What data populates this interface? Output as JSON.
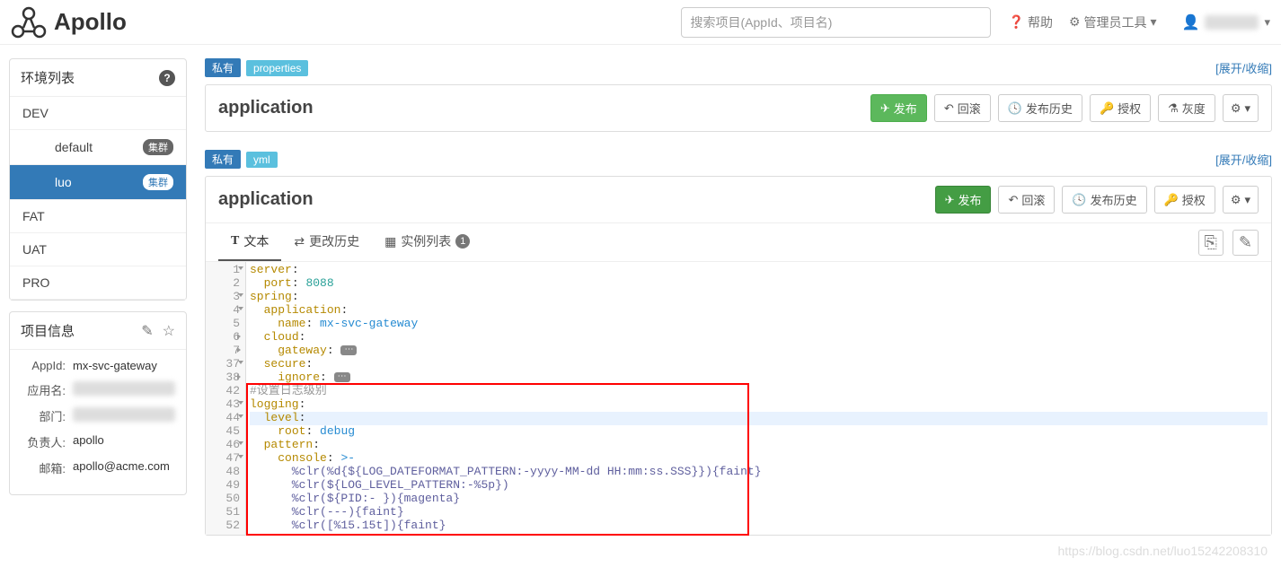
{
  "brand": "Apollo",
  "search": {
    "placeholder": "搜索项目(AppId、项目名)"
  },
  "top": {
    "help": "帮助",
    "admin": "管理员工具"
  },
  "sidebar": {
    "env_title": "环境列表",
    "items": [
      {
        "label": "DEV",
        "indent": false,
        "badge": "",
        "active": false
      },
      {
        "label": "default",
        "indent": true,
        "badge": "集群",
        "active": false
      },
      {
        "label": "luo",
        "indent": true,
        "badge": "集群",
        "active": true
      },
      {
        "label": "FAT",
        "indent": false,
        "badge": "",
        "active": false
      },
      {
        "label": "UAT",
        "indent": false,
        "badge": "",
        "active": false
      },
      {
        "label": "PRO",
        "indent": false,
        "badge": "",
        "active": false
      }
    ],
    "info_title": "项目信息",
    "info": {
      "appid_label": "AppId:",
      "appid": "mx-svc-gateway",
      "appname_label": "应用名:",
      "dept_label": "部门:",
      "owner_label": "负责人:",
      "owner": "apollo",
      "email_label": "邮箱:",
      "email": "apollo@acme.com"
    }
  },
  "ns1": {
    "private": "私有",
    "type": "properties",
    "expand": "[展开/收缩]",
    "title": "application",
    "actions": {
      "publish": "发布",
      "rollback": "回滚",
      "history": "发布历史",
      "auth": "授权",
      "gray": "灰度"
    }
  },
  "ns2": {
    "private": "私有",
    "type": "yml",
    "expand": "[展开/收缩]",
    "title": "application",
    "actions": {
      "publish": "发布",
      "rollback": "回滚",
      "history": "发布历史",
      "auth": "授权"
    },
    "tabs": {
      "text": "文本",
      "history": "更改历史",
      "instances": "实例列表",
      "count": "1"
    },
    "code": {
      "lines": [
        {
          "n": 1,
          "fold": "down",
          "raw": "server:",
          "cls": "key"
        },
        {
          "n": 2,
          "fold": "",
          "raw": "  port: 8088"
        },
        {
          "n": 3,
          "fold": "down",
          "raw": "spring:"
        },
        {
          "n": 4,
          "fold": "down",
          "raw": "  application:"
        },
        {
          "n": 5,
          "fold": "",
          "raw": "    name: mx-svc-gateway"
        },
        {
          "n": 6,
          "fold": "right",
          "raw": "  cloud:"
        },
        {
          "n": 7,
          "fold": "right",
          "raw": "    gateway:",
          "folded": true
        },
        {
          "n": 37,
          "fold": "down",
          "raw": "  secure:"
        },
        {
          "n": 38,
          "fold": "right",
          "raw": "    ignore:",
          "folded": true
        },
        {
          "n": 42,
          "fold": "",
          "raw": "#设置日志级别",
          "cls": "comment"
        },
        {
          "n": 43,
          "fold": "down",
          "raw": "logging:"
        },
        {
          "n": 44,
          "fold": "down",
          "raw": "  level:",
          "hl": true
        },
        {
          "n": 45,
          "fold": "",
          "raw": "    root: debug"
        },
        {
          "n": 46,
          "fold": "down",
          "raw": "  pattern:"
        },
        {
          "n": 47,
          "fold": "down",
          "raw": "    console: >-"
        },
        {
          "n": 48,
          "fold": "",
          "raw": "      %clr(%d{${LOG_DATEFORMAT_PATTERN:-yyyy-MM-dd HH:mm:ss.SSS}}){faint}",
          "cls": "str"
        },
        {
          "n": 49,
          "fold": "",
          "raw": "      %clr(${LOG_LEVEL_PATTERN:-%5p})",
          "cls": "str"
        },
        {
          "n": 50,
          "fold": "",
          "raw": "      %clr(${PID:- }){magenta}",
          "cls": "str"
        },
        {
          "n": 51,
          "fold": "",
          "raw": "      %clr(---){faint}",
          "cls": "str"
        },
        {
          "n": 52,
          "fold": "",
          "raw": "      %clr([%15.15t]){faint}",
          "cls": "str"
        }
      ]
    }
  },
  "watermark": "https://blog.csdn.net/luo15242208310"
}
